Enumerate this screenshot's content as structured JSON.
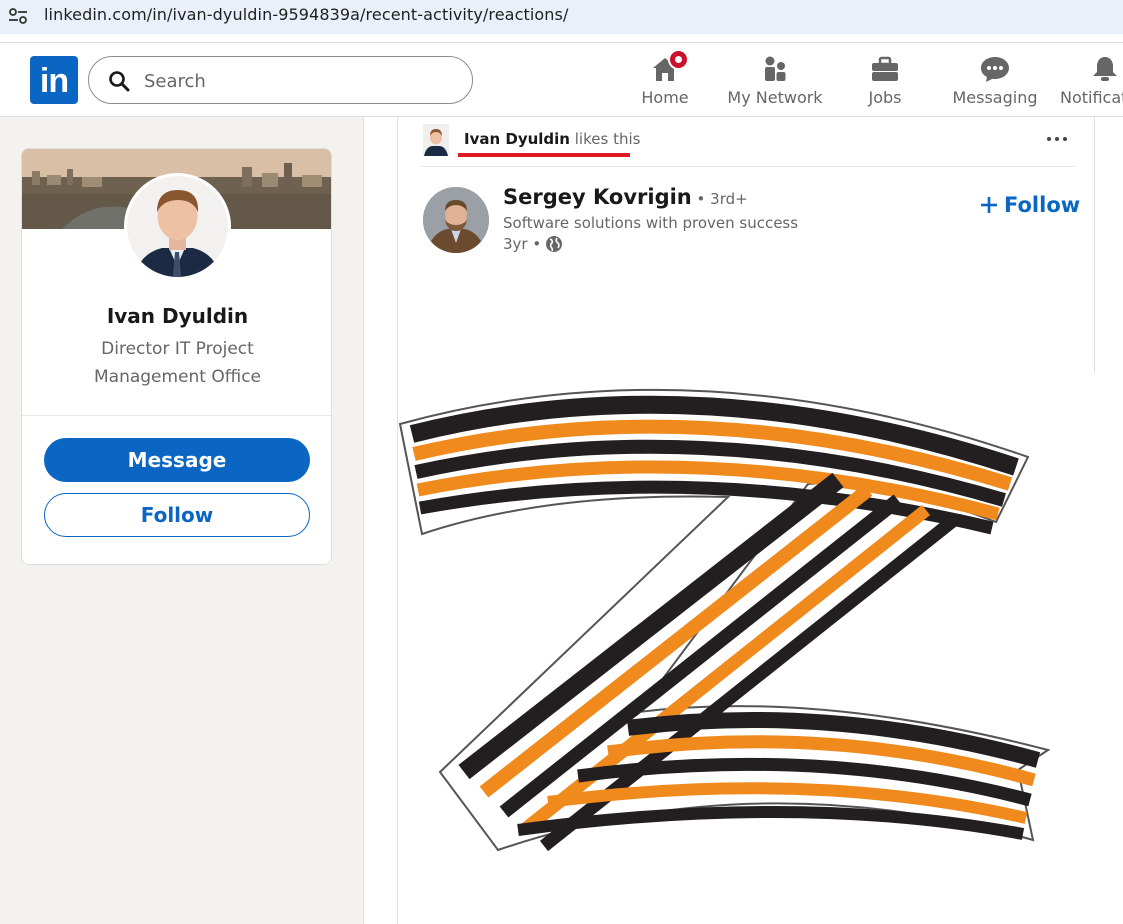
{
  "browser": {
    "url": "linkedin.com/in/ivan-dyuldin-9594839a/recent-activity/reactions/",
    "site_info_icon": "tune-icon"
  },
  "nav": {
    "logo_text": "in",
    "search_placeholder": "Search",
    "items": [
      {
        "label": "Home",
        "icon": "home-icon",
        "badge": true
      },
      {
        "label": "My Network",
        "icon": "network-icon"
      },
      {
        "label": "Jobs",
        "icon": "briefcase-icon"
      },
      {
        "label": "Messaging",
        "icon": "messaging-icon"
      },
      {
        "label": "Notificat",
        "icon": "bell-icon"
      }
    ]
  },
  "profile": {
    "name": "Ivan Dyuldin",
    "headline": "Director IT Project Management Office",
    "message_label": "Message",
    "follow_label": "Follow"
  },
  "post": {
    "liker_name": "Ivan Dyuldin",
    "liker_action": " likes this",
    "author_name": "Sergey Kovrigin",
    "author_degree": " • 3rd+",
    "author_subtitle": "Software solutions with proven success",
    "author_time": "3yr •",
    "follow_label": "Follow"
  },
  "colors": {
    "brand": "#0a66c2",
    "highlight_underline": "#e01b24",
    "ribbon_orange": "#f08a1c",
    "ribbon_black": "#231f20"
  }
}
